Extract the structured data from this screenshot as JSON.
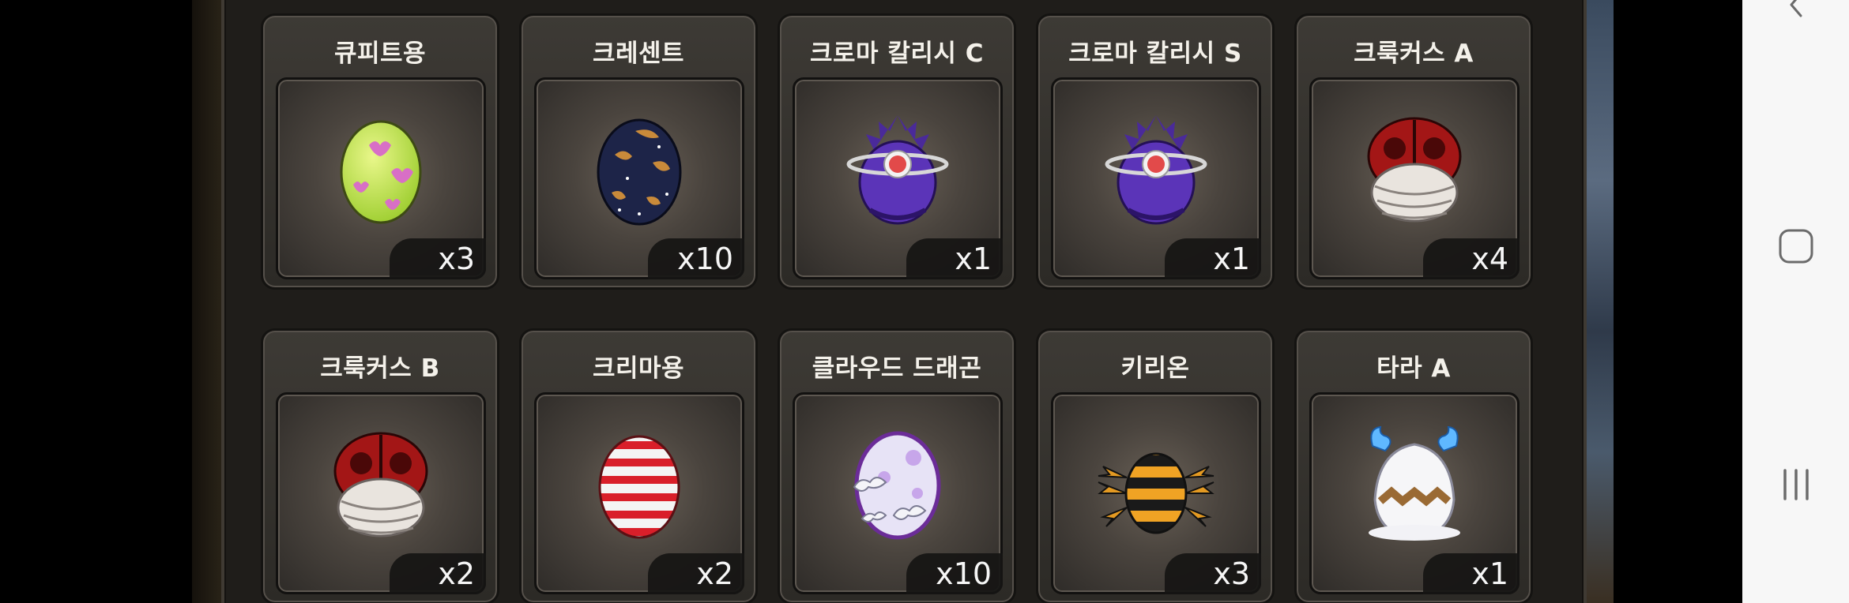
{
  "eggs": [
    {
      "name": "큐피트용",
      "qty": "x3",
      "icon": "cupid-egg-icon"
    },
    {
      "name": "크레센트",
      "qty": "x10",
      "icon": "crescent-egg-icon"
    },
    {
      "name": "크로마 칼리시 C",
      "qty": "x1",
      "icon": "chroma-calici-c-egg-icon"
    },
    {
      "name": "크로마 칼리시 S",
      "qty": "x1",
      "icon": "chroma-calici-s-egg-icon"
    },
    {
      "name": "크룩커스 A",
      "qty": "x4",
      "icon": "crookus-a-egg-icon"
    },
    {
      "name": "크룩커스 B",
      "qty": "x2",
      "icon": "crookus-b-egg-icon"
    },
    {
      "name": "크리마용",
      "qty": "x2",
      "icon": "krima-egg-icon"
    },
    {
      "name": "클라우드 드래곤",
      "qty": "x10",
      "icon": "cloud-dragon-egg-icon"
    },
    {
      "name": "키리온",
      "qty": "x3",
      "icon": "kirion-egg-icon"
    },
    {
      "name": "타라 A",
      "qty": "x1",
      "icon": "tara-a-egg-icon"
    }
  ],
  "system_nav": {
    "back": "back-icon",
    "home": "home-icon",
    "recents": "recents-icon"
  }
}
